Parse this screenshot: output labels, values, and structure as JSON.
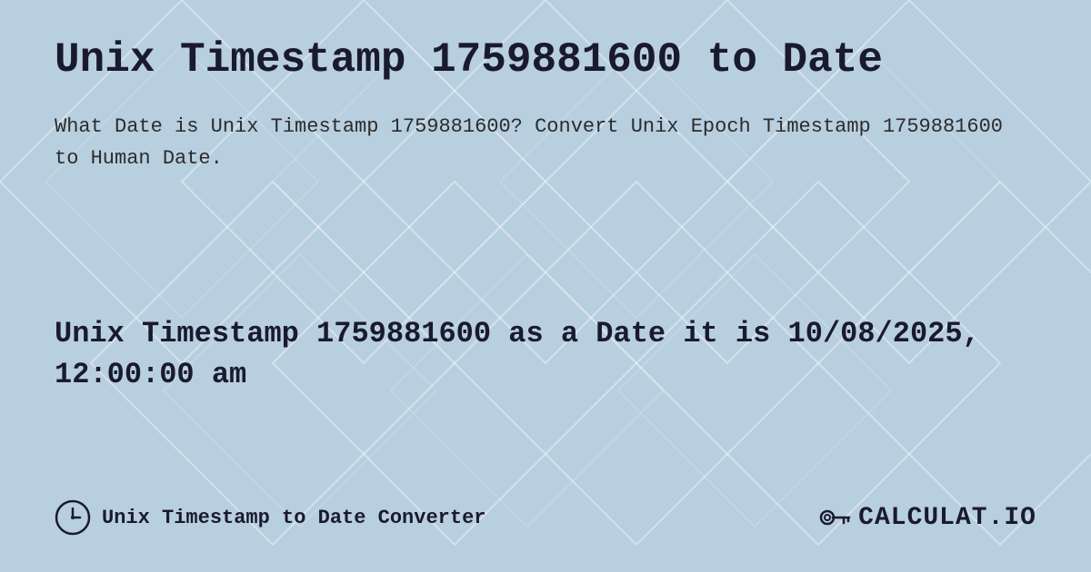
{
  "page": {
    "title": "Unix Timestamp 1759881600 to Date",
    "description": "What Date is Unix Timestamp 1759881600? Convert Unix Epoch Timestamp 1759881600 to Human Date.",
    "result": "Unix Timestamp 1759881600 as a Date it is 10/08/2025, 12:00:00 am",
    "footer_label": "Unix Timestamp to Date Converter",
    "logo_text": "CALCULAT.IO",
    "background_color": "#c8d8e8",
    "accent_color": "#1a1a2e"
  }
}
